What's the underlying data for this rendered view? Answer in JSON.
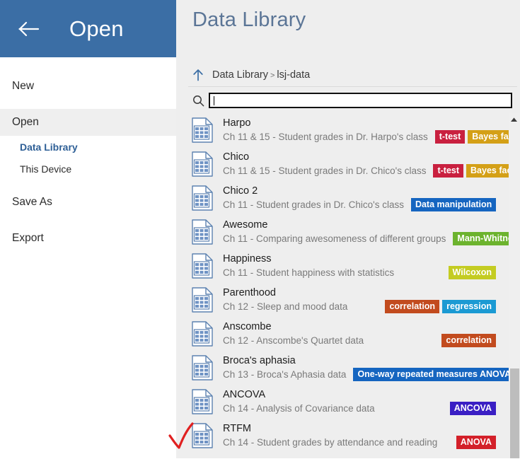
{
  "window": {
    "back_button_icon": "back-arrow-icon",
    "back_title": "Open"
  },
  "sidebar": {
    "items": [
      {
        "label": "New",
        "type": "item",
        "active": false
      },
      {
        "label": "Open",
        "type": "item",
        "active": true
      },
      {
        "label": "Data Library",
        "type": "sub",
        "selected": true
      },
      {
        "label": "This Device",
        "type": "sub",
        "selected": false
      },
      {
        "label": "Save As",
        "type": "item",
        "active": false
      },
      {
        "label": "Export",
        "type": "item",
        "active": false
      }
    ]
  },
  "main": {
    "title": "Data Library",
    "breadcrumb": {
      "up_icon": "up-arrow-icon",
      "root": "Data Library",
      "separator": ">",
      "current": "lsj-data"
    },
    "search": {
      "icon": "search-icon",
      "value": "",
      "placeholder": ""
    },
    "scrollbar": {
      "up_icon": "chevron-up-icon"
    },
    "files": [
      {
        "name": "Harpo",
        "description": "Ch 11 & 15 - Student grades in Dr. Harpo's class",
        "tags": [
          {
            "label": "t-test",
            "color": "#c9203f"
          },
          {
            "label": "Bayes factor",
            "color": "#d4a017"
          }
        ]
      },
      {
        "name": "Chico",
        "description": "Ch 11 & 15 - Student grades in Dr. Chico's class",
        "tags": [
          {
            "label": "t-test",
            "color": "#c9203f"
          },
          {
            "label": "Bayes factor",
            "color": "#d4a017"
          }
        ]
      },
      {
        "name": "Chico 2",
        "description": "Ch 11 - Student grades in Dr. Chico's class",
        "tags": [
          {
            "label": "Data manipulation",
            "color": "#1565c0"
          }
        ]
      },
      {
        "name": "Awesome",
        "description": "Ch 11 - Comparing awesomeness of different groups",
        "tags": [
          {
            "label": "Mann-Whitney",
            "color": "#6cb32e"
          }
        ]
      },
      {
        "name": "Happiness",
        "description": "Ch 11 - Student happiness with statistics",
        "tags": [
          {
            "label": "Wilcoxon",
            "color": "#c4cc22"
          }
        ]
      },
      {
        "name": "Parenthood",
        "description": "Ch 12 - Sleep and mood data",
        "tags": [
          {
            "label": "correlation",
            "color": "#c24b1e"
          },
          {
            "label": "regression",
            "color": "#1b9ad3"
          }
        ]
      },
      {
        "name": "Anscombe",
        "description": "Ch 12 - Anscombe's Quartet data",
        "tags": [
          {
            "label": "correlation",
            "color": "#c24b1e"
          }
        ]
      },
      {
        "name": "Broca's aphasia",
        "description": "Ch 13 - Broca's Aphasia data",
        "tags": [
          {
            "label": "One-way repeated measures ANOVA",
            "color": "#1565c0"
          }
        ]
      },
      {
        "name": "ANCOVA",
        "description": "Ch 14 - Analysis of Covariance data",
        "tags": [
          {
            "label": "ANCOVA",
            "color": "#3a1fc4"
          }
        ]
      },
      {
        "name": "RTFM",
        "description": "Ch 14 - Student grades by attendance and reading",
        "tags": [
          {
            "label": "ANOVA",
            "color": "#d32029"
          }
        ]
      }
    ]
  },
  "annotation": {
    "type": "checkmark",
    "color": "#e02020",
    "target": "RTFM"
  },
  "colors": {
    "header_blue": "#3b6ea5",
    "accent_blue": "#2e5f96",
    "panel_bg": "#eeeeee"
  }
}
